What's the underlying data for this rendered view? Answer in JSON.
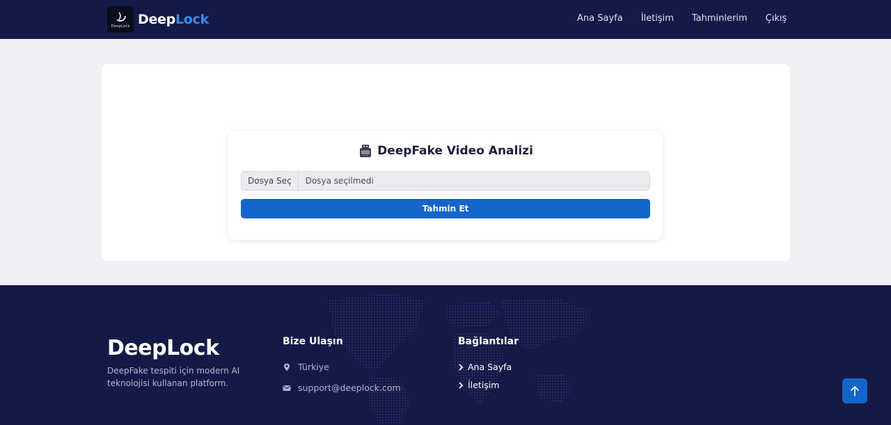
{
  "navbar": {
    "brand": {
      "part1": "Deep",
      "part2": "Lock",
      "logo_text": "DeepLock"
    },
    "links": [
      {
        "label": "Ana Sayfa"
      },
      {
        "label": "İletişim"
      },
      {
        "label": "Tahminlerim"
      },
      {
        "label": "Çıkış"
      }
    ]
  },
  "form": {
    "title": "DeepFake Video Analizi",
    "title_icon": "video-camera-icon",
    "file_button_label": "Dosya Seç",
    "file_status": "Dosya seçilmedi",
    "submit_label": "Tahmin Et"
  },
  "footer": {
    "brand": "DeepLock",
    "description": "DeepFake tespiti için modern AI teknolojisi kullanan platform.",
    "contact": {
      "title": "Bize Ulaşın",
      "location": "Türkiye",
      "email": "support@deeplock.com"
    },
    "links": {
      "title": "Bağlantılar",
      "items": [
        {
          "label": "Ana Sayfa"
        },
        {
          "label": "İletişim"
        }
      ]
    }
  },
  "scroll_top_icon": "arrow-up-icon",
  "colors": {
    "navbar_bg": "#141a47",
    "footer_bg": "#141a47",
    "accent": "#3b8cf0",
    "primary_button": "#1565c8",
    "page_bg": "#eef0f5"
  }
}
